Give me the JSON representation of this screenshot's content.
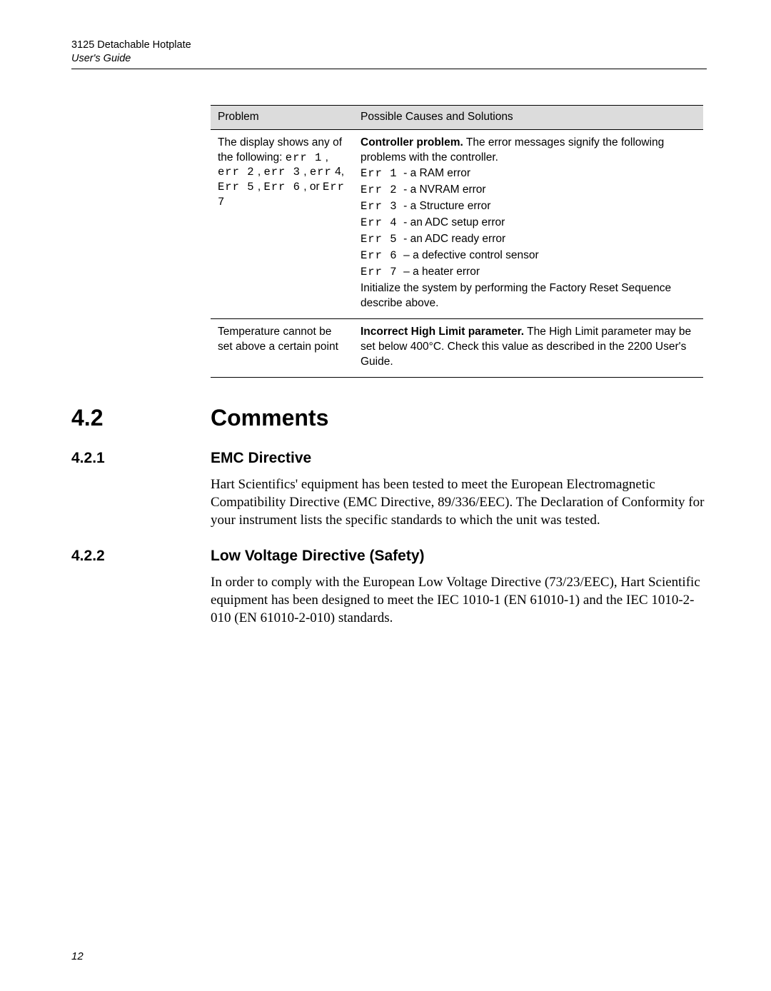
{
  "running_head": {
    "title": "3125 Detachable Hotplate",
    "sub": "User's Guide"
  },
  "table": {
    "headers": [
      "Problem",
      "Possible Causes and Solutions"
    ],
    "rows": [
      {
        "problem_html": "The display shows any of the following: <span class=\"mono\">err 1</span> , <span class=\"mono\">err 2</span> , <span class=\"mono\">err 3</span> , <span class=\"mono\">err</span> 4, <span class=\"mono\">Err 5</span> , <span class=\"mono\">Err 6</span> , or <span class=\"mono\">Err 7</span>",
        "solution_lead": "<b>Controller problem.</b> The error messages signify the following problems with the controller.",
        "errs": [
          {
            "label": "Err 1",
            "text": "- a RAM error"
          },
          {
            "label": "Err 2",
            "text": "- a NVRAM error"
          },
          {
            "label": "Err 3",
            "text": "- a Structure error"
          },
          {
            "label": "Err 4",
            "text": "- an ADC setup error"
          },
          {
            "label": "Err 5",
            "text": "- an ADC ready error"
          },
          {
            "label": "Err 6",
            "text": "– a defective control sensor"
          },
          {
            "label": "Err 7",
            "text": "– a heater error"
          }
        ],
        "solution_tail": "Initialize the system by performing the Factory Reset Sequence describe above."
      },
      {
        "problem": "Temperature cannot be set above a certain point",
        "solution": "<b>Incorrect High Limit parameter.</b> The High Limit parameter may be set below 400°C. Check this value as described in the 2200 User's Guide."
      }
    ]
  },
  "s42": {
    "num": "4.2",
    "title": "Comments"
  },
  "s421": {
    "num": "4.2.1",
    "title": "EMC Directive",
    "p": "Hart Scientifics' equipment has been tested to meet the European Electromagnetic Compatibility Directive (EMC Directive, 89/336/EEC). The Declaration of Conformity for your instrument lists the specific standards to which the unit was tested."
  },
  "s422": {
    "num": "4.2.2",
    "title": "Low Voltage Directive (Safety)",
    "p": "In order to comply with the European Low Voltage Directive (73/23/EEC), Hart Scientific equipment has been designed to meet the IEC 1010-1 (EN 61010-1) and the IEC 1010-2-010 (EN 61010-2-010) standards."
  },
  "page_num": "12"
}
